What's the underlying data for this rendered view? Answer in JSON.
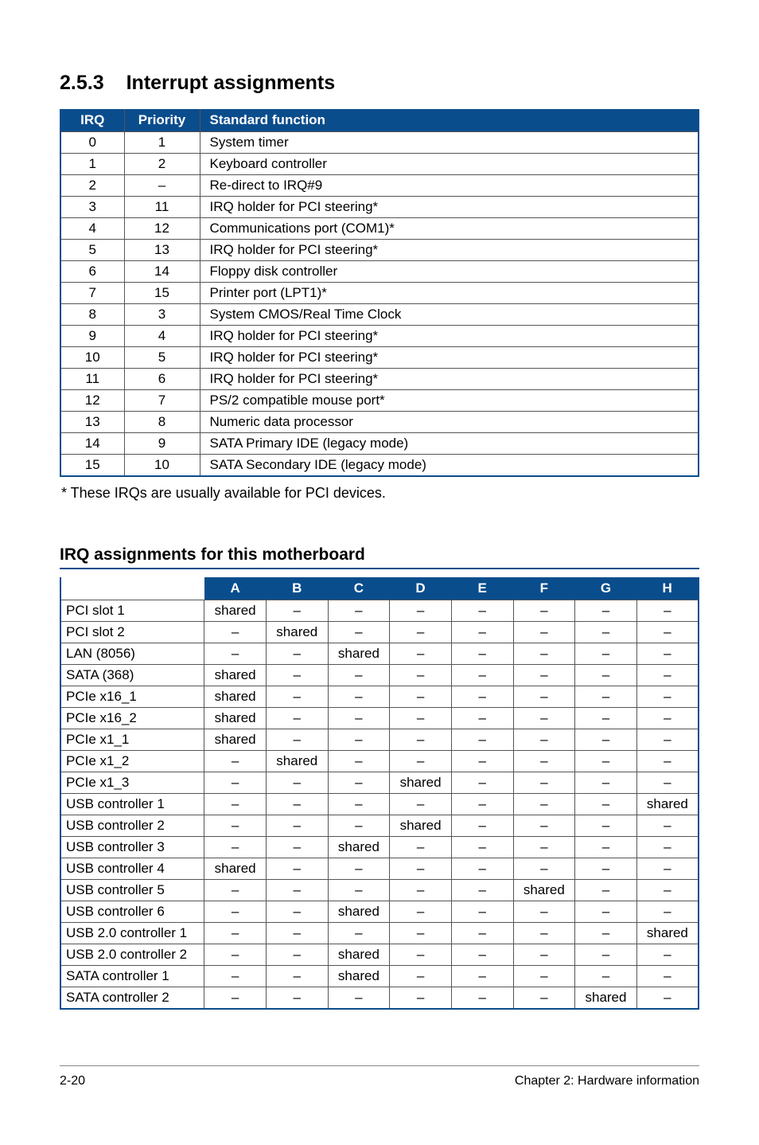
{
  "heading": {
    "number": "2.5.3",
    "title": "Interrupt assignments"
  },
  "table1": {
    "headers": [
      "IRQ",
      "Priority",
      "Standard function"
    ],
    "rows": [
      [
        "0",
        "1",
        "System timer"
      ],
      [
        "1",
        "2",
        "Keyboard controller"
      ],
      [
        "2",
        "–",
        "Re-direct to IRQ#9"
      ],
      [
        "3",
        "11",
        "IRQ holder for PCI steering*"
      ],
      [
        "4",
        "12",
        "Communications port (COM1)*"
      ],
      [
        "5",
        "13",
        "IRQ holder for PCI steering*"
      ],
      [
        "6",
        "14",
        "Floppy disk controller"
      ],
      [
        "7",
        "15",
        "Printer port (LPT1)*"
      ],
      [
        "8",
        "3",
        "System CMOS/Real Time Clock"
      ],
      [
        "9",
        "4",
        "IRQ holder for PCI steering*"
      ],
      [
        "10",
        "5",
        "IRQ holder for PCI steering*"
      ],
      [
        "11",
        "6",
        "IRQ holder for PCI steering*"
      ],
      [
        "12",
        "7",
        "PS/2 compatible mouse port*"
      ],
      [
        "13",
        "8",
        "Numeric data processor"
      ],
      [
        "14",
        "9",
        "SATA Primary IDE (legacy mode)"
      ],
      [
        "15",
        "10",
        "SATA Secondary IDE (legacy mode)"
      ]
    ]
  },
  "footnote": "* These IRQs are usually available for PCI devices.",
  "subheading": "IRQ assignments for this motherboard",
  "table2": {
    "headers": [
      "",
      "A",
      "B",
      "C",
      "D",
      "E",
      "F",
      "G",
      "H"
    ],
    "rows": [
      [
        "PCI slot 1",
        "shared",
        "–",
        "–",
        "–",
        "–",
        "–",
        "–",
        "–"
      ],
      [
        "PCI slot 2",
        "–",
        "shared",
        "–",
        "–",
        "–",
        "–",
        "–",
        "–"
      ],
      [
        "LAN (8056)",
        "–",
        "–",
        "shared",
        "–",
        "–",
        "–",
        "–",
        "–"
      ],
      [
        "SATA (368)",
        "shared",
        "–",
        "–",
        "–",
        "–",
        "–",
        "–",
        "–"
      ],
      [
        "PCIe x16_1",
        "shared",
        "–",
        "–",
        "–",
        "–",
        "–",
        "–",
        "–"
      ],
      [
        "PCIe x16_2",
        "shared",
        "–",
        "–",
        "–",
        "–",
        "–",
        "–",
        "–"
      ],
      [
        "PCIe x1_1",
        "shared",
        "–",
        "–",
        "–",
        "–",
        "–",
        "–",
        "–"
      ],
      [
        "PCIe x1_2",
        "–",
        "shared",
        "–",
        "–",
        "–",
        "–",
        "–",
        "–"
      ],
      [
        "PCIe x1_3",
        "–",
        "–",
        "–",
        "shared",
        "–",
        "–",
        "–",
        "–"
      ],
      [
        "USB controller 1",
        "–",
        "–",
        "–",
        "–",
        "–",
        "–",
        "–",
        "shared"
      ],
      [
        "USB controller 2",
        "–",
        "–",
        "–",
        "shared",
        "–",
        "–",
        "–",
        "–"
      ],
      [
        "USB controller 3",
        "–",
        "–",
        "shared",
        "–",
        "–",
        "–",
        "–",
        "–"
      ],
      [
        "USB controller 4",
        "shared",
        "–",
        "–",
        "–",
        "–",
        "–",
        "–",
        "–"
      ],
      [
        "USB controller 5",
        "–",
        "–",
        "–",
        "–",
        "–",
        "shared",
        "–",
        "–"
      ],
      [
        "USB controller 6",
        "–",
        "–",
        "shared",
        "–",
        "–",
        "–",
        "–",
        "–"
      ],
      [
        "USB 2.0 controller 1",
        "–",
        "–",
        "–",
        "–",
        "–",
        "–",
        "–",
        "shared"
      ],
      [
        "USB 2.0 controller 2",
        "–",
        "–",
        "shared",
        "–",
        "–",
        "–",
        "–",
        "–"
      ],
      [
        "SATA controller 1",
        "–",
        "–",
        "shared",
        "–",
        "–",
        "–",
        "–",
        "–"
      ],
      [
        "SATA controller 2",
        "–",
        "–",
        "–",
        "–",
        "–",
        "–",
        "shared",
        "–"
      ]
    ]
  },
  "footer": {
    "left": "2-20",
    "right": "Chapter 2: Hardware information"
  }
}
